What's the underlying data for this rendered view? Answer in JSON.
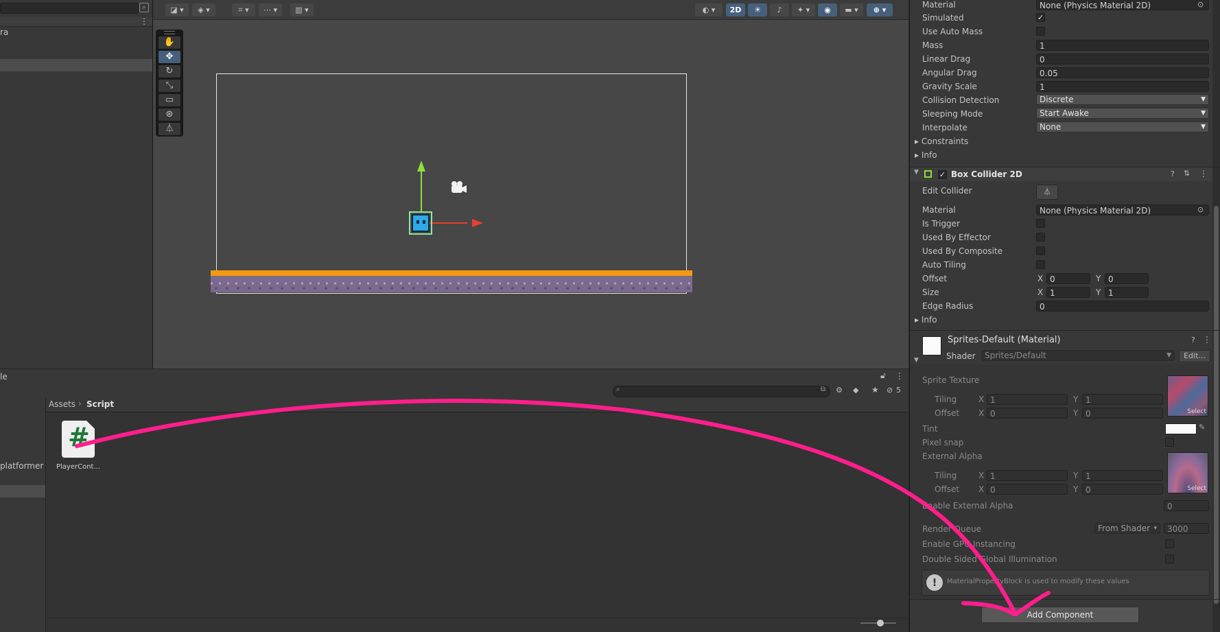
{
  "hierarchy": {
    "rows": [
      {
        "label": "ra"
      },
      {
        "label": ""
      }
    ]
  },
  "scene_toolbar": {
    "mode_2d": "2D"
  },
  "project": {
    "header_partial": "le",
    "hidden_count": "5",
    "breadcrumb": {
      "root": "Assets",
      "current": "Script"
    },
    "folder_partial": "platformer",
    "asset": {
      "name": "PlayerCont...",
      "icon_glyph": "#"
    }
  },
  "inspector": {
    "rigidbody": {
      "material": {
        "label": "Material",
        "value": "None (Physics Material 2D)"
      },
      "simulated": {
        "label": "Simulated",
        "checked": true
      },
      "use_auto_mass": {
        "label": "Use Auto Mass",
        "checked": false
      },
      "mass": {
        "label": "Mass",
        "value": "1"
      },
      "linear_drag": {
        "label": "Linear Drag",
        "value": "0"
      },
      "angular_drag": {
        "label": "Angular Drag",
        "value": "0.05"
      },
      "gravity_scale": {
        "label": "Gravity Scale",
        "value": "1"
      },
      "collision_detection": {
        "label": "Collision Detection",
        "value": "Discrete"
      },
      "sleeping_mode": {
        "label": "Sleeping Mode",
        "value": "Start Awake"
      },
      "interpolate": {
        "label": "Interpolate",
        "value": "None"
      },
      "constraints": "Constraints",
      "info": "Info"
    },
    "box_collider": {
      "title": "Box Collider 2D",
      "edit_collider": {
        "label": "Edit Collider"
      },
      "material": {
        "label": "Material",
        "value": "None (Physics Material 2D)"
      },
      "is_trigger": {
        "label": "Is Trigger"
      },
      "used_by_effector": {
        "label": "Used By Effector"
      },
      "used_by_composite": {
        "label": "Used By Composite"
      },
      "auto_tiling": {
        "label": "Auto Tiling"
      },
      "offset": {
        "label": "Offset",
        "x": "0",
        "y": "0"
      },
      "size": {
        "label": "Size",
        "x": "1",
        "y": "1"
      },
      "edge_radius": {
        "label": "Edge Radius",
        "value": "0"
      },
      "info": "Info"
    },
    "material": {
      "title": "Sprites-Default (Material)",
      "shader_label": "Shader",
      "shader_value": "Sprites/Default",
      "edit_label": "Edit...",
      "sprite_texture": "Sprite Texture",
      "tiling1": {
        "label": "Tiling",
        "x": "1",
        "y": "1"
      },
      "offset1": {
        "label": "Offset",
        "x": "0",
        "y": "0"
      },
      "select_label": "Select",
      "tint": "Tint",
      "pixel_snap": "Pixel snap",
      "external_alpha": "External Alpha",
      "tiling2": {
        "label": "Tiling",
        "x": "1",
        "y": "1"
      },
      "offset2": {
        "label": "Offset",
        "x": "0",
        "y": "0"
      },
      "enable_external_alpha": {
        "label": "Enable External Alpha",
        "value": "0"
      },
      "render_queue": {
        "label": "Render Queue",
        "mode": "From Shader",
        "value": "3000"
      },
      "gpu_instancing": "Enable GPU Instancing",
      "double_sided_gi": "Double Sided Global Illumination",
      "help": "MaterialPropertyBlock is used to modify these values"
    },
    "add_component": "Add Component",
    "x_label": "X",
    "y_label": "Y"
  },
  "colors": {
    "annotation": "#ff1e8c",
    "ground_top": "#f59a10",
    "ground_bottom": "#7b6a8e",
    "player": "#2fa8e6",
    "axis_x": "#e8402f",
    "axis_y": "#8ddf3a"
  }
}
